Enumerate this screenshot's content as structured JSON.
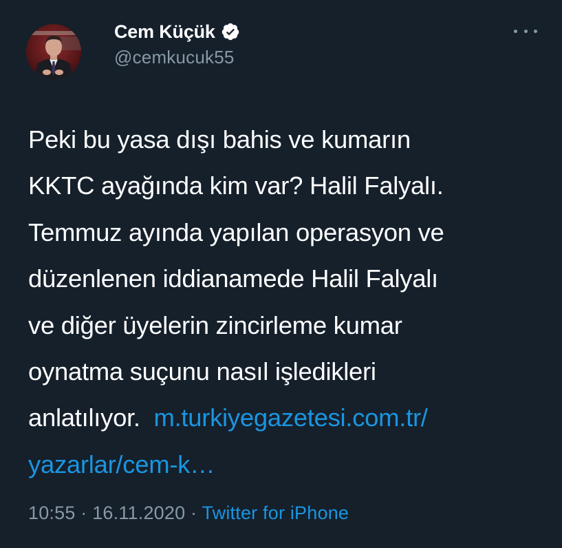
{
  "author": {
    "display_name": "Cem Küçük",
    "handle": "@cemkucuk55",
    "verified": true,
    "verified_icon": "verified-badge-icon",
    "avatar_icon": "profile-photo"
  },
  "menu": {
    "icon": "more-horizontal-icon"
  },
  "tweet": {
    "lines": [
      "Peki bu yasa dışı bahis ve kumarın",
      "KKTC ayağında kim var? Halil Falyalı.",
      "Temmuz ayında yapılan operasyon ve",
      "düzenlenen iddianamede Halil Falyalı",
      "ve diğer üyelerin zincirleme kumar",
      "oynatma suçunu nasıl işledikleri"
    ],
    "last_text": "anlatılıyor.",
    "link_part1": "m.turkiyegazetesi.com.tr/",
    "link_part2": "yazarlar/cem-k…"
  },
  "meta": {
    "time": "10:55",
    "separator1": " · ",
    "date": "16.11.2020",
    "separator2": " · ",
    "source": "Twitter for iPhone"
  },
  "colors": {
    "background": "#15202b",
    "text": "#ffffff",
    "secondary": "#8899a6",
    "link": "#1b95e0"
  }
}
